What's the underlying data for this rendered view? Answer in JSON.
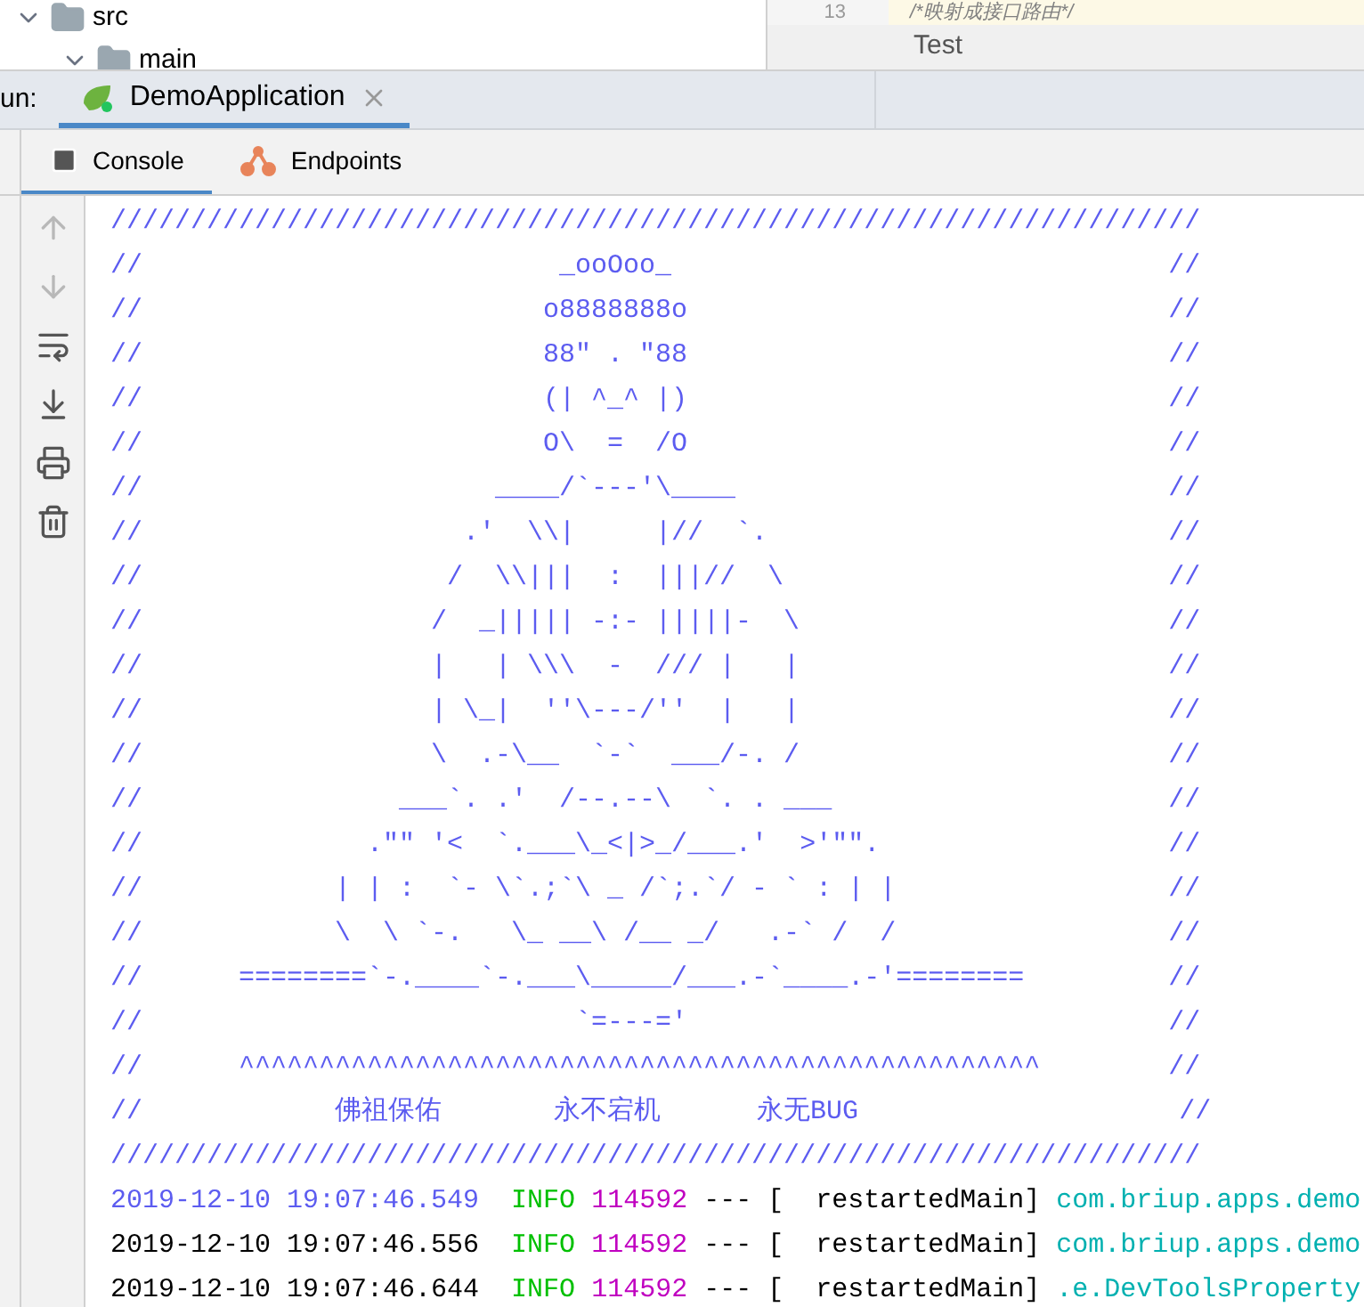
{
  "project_tree": [
    {
      "label": "src",
      "expanded": true,
      "children": [
        {
          "label": "main",
          "expanded": true
        }
      ]
    }
  ],
  "editor": {
    "line_number": "13",
    "code_line": "/*映射成接口路由*/",
    "breadcrumb": "Test"
  },
  "run_panel": {
    "label": "un:",
    "tabs": [
      {
        "label": "DemoApplication",
        "selected": true
      }
    ],
    "subtabs": [
      {
        "label": "Console",
        "kind": "console",
        "selected": true
      },
      {
        "label": "Endpoints",
        "kind": "endpoints",
        "selected": false
      }
    ],
    "toolbar": [
      {
        "kind": "up",
        "disabled": true
      },
      {
        "kind": "down",
        "disabled": true
      },
      {
        "kind": "wrap",
        "disabled": false
      },
      {
        "kind": "scroll-end",
        "disabled": false
      },
      {
        "kind": "print",
        "disabled": false
      },
      {
        "kind": "trash",
        "disabled": false
      }
    ]
  },
  "console": {
    "banner": [
      "////////////////////////////////////////////////////////////////////",
      "//                          _ooOoo_                               //",
      "//                         o8888888o                              //",
      "//                         88\" . \"88                              //",
      "//                         (| ^_^ |)                              //",
      "//                         O\\  =  /O                              //",
      "//                      ____/`---'\\____                           //",
      "//                    .'  \\\\|     |//  `.                         //",
      "//                   /  \\\\|||  :  |||//  \\                        //",
      "//                  /  _||||| -:- |||||-  \\                       //",
      "//                  |   | \\\\\\  -  /// |   |                       //",
      "//                  | \\_|  ''\\---/''  |   |                       //",
      "//                  \\  .-\\__  `-`  ___/-. /                       //",
      "//                ___`. .'  /--.--\\  `. . ___                     //",
      "//              .\"\" '<  `.___\\_<|>_/___.'  >'\"\".                  //",
      "//            | | :  `- \\`.;`\\ _ /`;.`/ - ` : | |                 //",
      "//            \\  \\ `-.   \\_ __\\ /__ _/   .-` /  /                 //",
      "//      ========`-.____`-.___\\_____/___.-`____.-'========         //",
      "//                           `=---='                              //",
      "//      ^^^^^^^^^^^^^^^^^^^^^^^^^^^^^^^^^^^^^^^^^^^^^^^^^^        //",
      "//            佛祖保佑       永不宕机      永无BUG                    //",
      "////////////////////////////////////////////////////////////////////"
    ],
    "logs": [
      {
        "timestamp": "2019-12-10 19:07:46.549",
        "color": "#5c5cf0",
        "level": "INFO",
        "pid": "114592",
        "separator": "---",
        "thread": "[  restartedMain]",
        "logger": "com.briup.apps.demo"
      },
      {
        "timestamp": "2019-12-10 19:07:46.556",
        "color": "#000000",
        "level": "INFO",
        "pid": "114592",
        "separator": "---",
        "thread": "[  restartedMain]",
        "logger": "com.briup.apps.demo"
      },
      {
        "timestamp": "2019-12-10 19:07:46.644",
        "color": "#000000",
        "level": "INFO",
        "pid": "114592",
        "separator": "---",
        "thread": "[  restartedMain]",
        "logger": ".e.DevToolsProperty"
      }
    ]
  }
}
